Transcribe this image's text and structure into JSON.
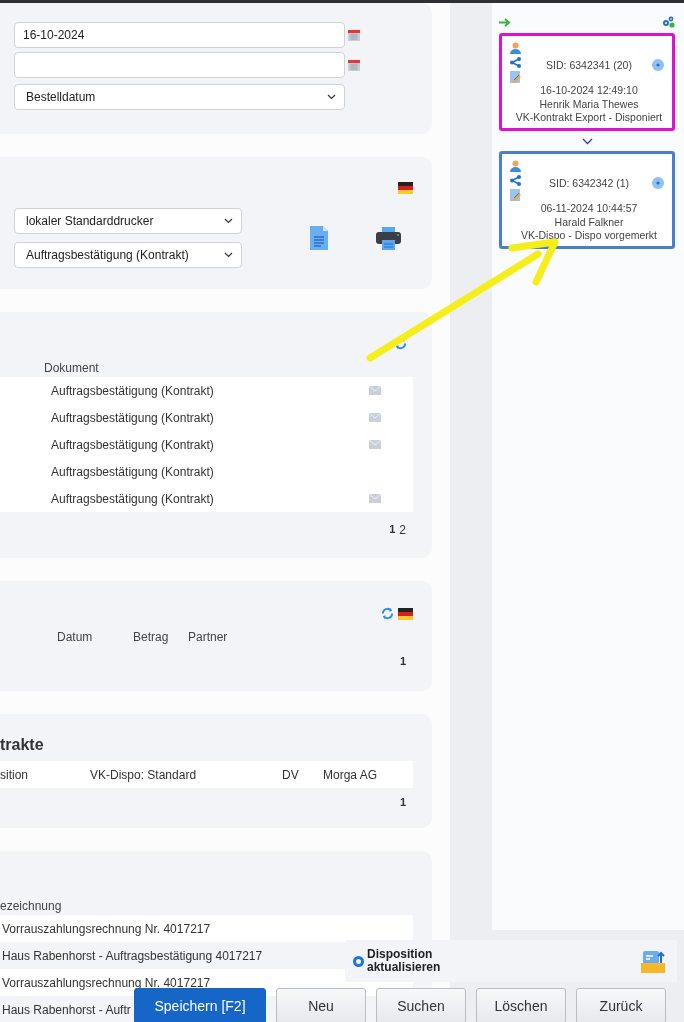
{
  "date_from": "16-10-2024",
  "date_type": "Bestelldatum",
  "print": {
    "printer": "lokaler Standarddrucker",
    "document": "Auftragsbestätigung (Kontrakt)"
  },
  "documents": {
    "columns": [
      "Dokument"
    ],
    "rows": [
      {
        "document": "Auftragsbestätigung (Kontrakt)",
        "mailed": true
      },
      {
        "document": "Auftragsbestätigung (Kontrakt)",
        "mailed": true
      },
      {
        "document": "Auftragsbestätigung (Kontrakt)",
        "mailed": true
      },
      {
        "document": "Auftragsbestätigung (Kontrakt)",
        "mailed": false
      },
      {
        "document": "Auftragsbestätigung (Kontrakt)",
        "mailed": true
      }
    ],
    "pages": [
      {
        "label": "1",
        "selected": true
      },
      {
        "label": "2",
        "selected": false
      }
    ]
  },
  "payments": {
    "columns": [
      "Datum",
      "Betrag",
      "Partner"
    ],
    "pages": [
      {
        "label": "1",
        "selected": true
      }
    ]
  },
  "contracts": {
    "title": "trakte",
    "rows": [
      {
        "cells": [
          "sition",
          "VK-Dispo: Standard",
          "DV",
          "Morga AG"
        ]
      }
    ],
    "pages": [
      {
        "label": "1",
        "selected": true
      }
    ]
  },
  "items": {
    "columns": [
      "ezeichnung"
    ],
    "rows": [
      {
        "name": "Vorrauszahlungsrechnung Nr. 4017217"
      },
      {
        "name": "Haus Rabenhorst - Auftragsbestätigung 4017217"
      },
      {
        "name": "Vorrauszahlungsrechnung Nr. 4017217"
      },
      {
        "name": "Haus Rabenhorst - Auftr"
      }
    ]
  },
  "workflow": {
    "steps": [
      {
        "sid": "SID: 6342341 (20)",
        "timestamp": "16-10-2024 12:49:10",
        "user": "Henrik Maria Thewes",
        "status": "VK-Kontrakt Export - Disponiert",
        "color": "#e010d0"
      },
      {
        "sid": "SID: 6342342 (1)",
        "timestamp": "06-11-2024 10:44:57",
        "user": "Harald Falkner",
        "status": "VK-Dispo - Dispo vorgemerkt",
        "color": "#4a7fd0"
      }
    ]
  },
  "disposition": {
    "label": "Disposition aktualisieren",
    "selected": true
  },
  "buttons": [
    {
      "label": "Speichern [F2]",
      "kind": "primary"
    },
    {
      "label": "Neu",
      "kind": "default"
    },
    {
      "label": "Suchen",
      "kind": "default"
    },
    {
      "label": "Löschen",
      "kind": "default"
    },
    {
      "label": "Zurück",
      "kind": "default"
    }
  ]
}
